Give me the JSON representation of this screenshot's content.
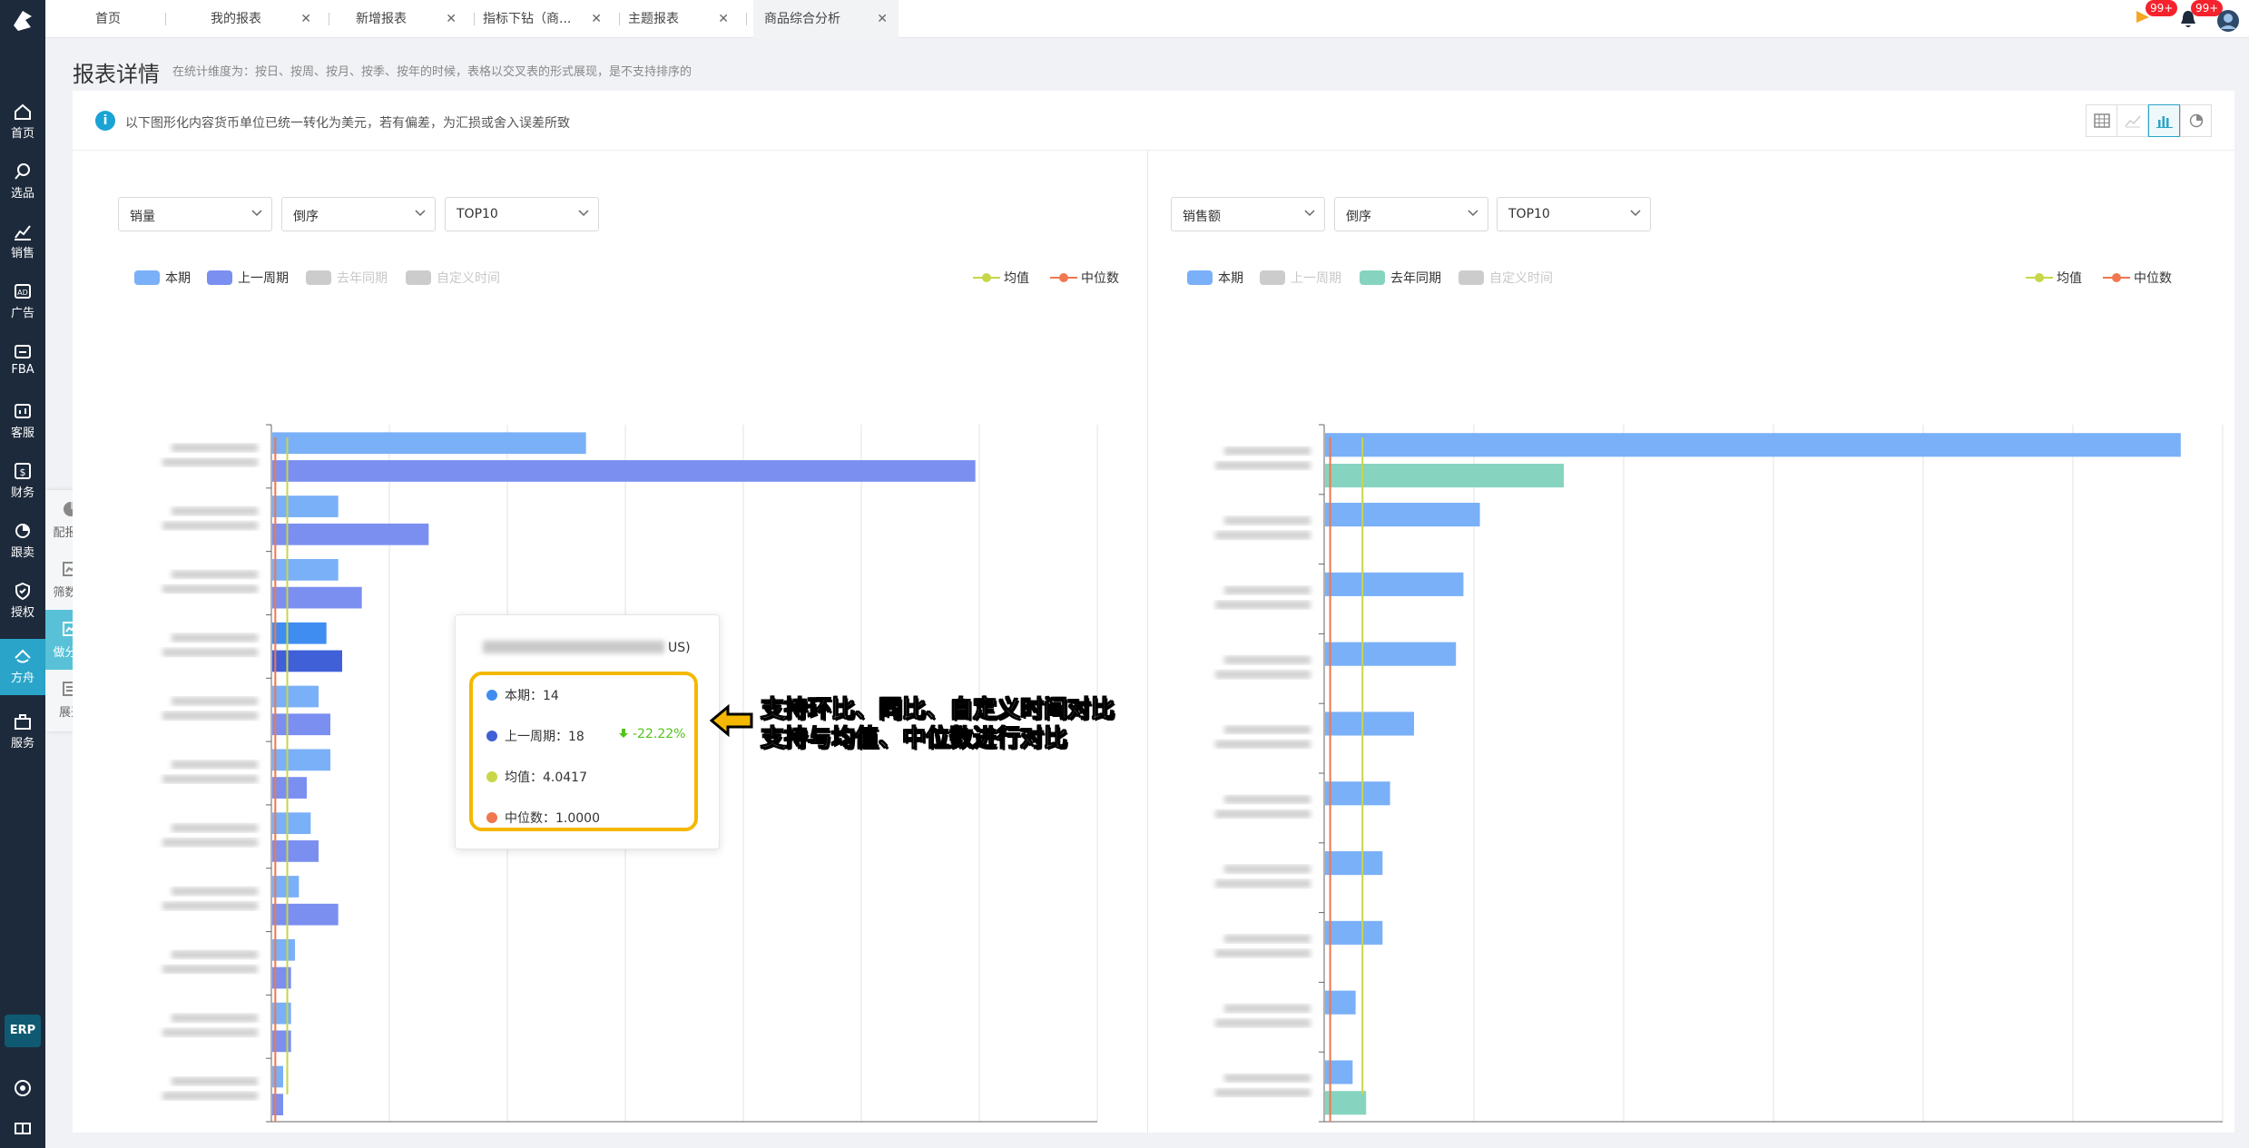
{
  "tabs": [
    {
      "label": "首页",
      "close": false
    },
    {
      "label": "我的报表",
      "close": true
    },
    {
      "label": "新增报表",
      "close": true
    },
    {
      "label": "指标下钻（商...",
      "close": true
    },
    {
      "label": "主题报表",
      "close": true
    },
    {
      "label": "商品综合分析",
      "close": true,
      "active": true
    }
  ],
  "notifications": {
    "flag_badge": "99+",
    "bell_badge": "99+"
  },
  "sidebar": [
    {
      "label": "首页",
      "icon": "home-icon"
    },
    {
      "label": "选品",
      "icon": "search-icon"
    },
    {
      "label": "销售",
      "icon": "trend-icon"
    },
    {
      "label": "广告",
      "icon": "ad-icon"
    },
    {
      "label": "FBA",
      "icon": "fba-icon"
    },
    {
      "label": "客服",
      "icon": "chat-icon"
    },
    {
      "label": "财务",
      "icon": "dollar-icon"
    },
    {
      "label": "跟卖",
      "icon": "pie-icon"
    },
    {
      "label": "授权",
      "icon": "shield-icon"
    },
    {
      "label": "方舟",
      "icon": "ark-icon",
      "active": true
    },
    {
      "label": "服务",
      "icon": "service-icon"
    }
  ],
  "erp_label": "ERP",
  "flyout": [
    {
      "label": "配报表",
      "icon": "pie-chart-icon"
    },
    {
      "label": "筛数据",
      "icon": "filter-data-icon"
    },
    {
      "label": "做分析",
      "icon": "analysis-icon",
      "active": true
    },
    {
      "label": "展开",
      "icon": "expand-icon"
    }
  ],
  "page": {
    "title": "报表详情",
    "subtitle": "在统计维度为：按日、按周、按月、按季、按年的时候，表格以交叉表的形式展现，是不支持排序的"
  },
  "notice": "以下图形化内容货币单位已统一转化为美元，若有偏差，为汇损或舍入误差所致",
  "colors": {
    "current": "#7ab0f7",
    "prev_period": "#7b8ff0",
    "last_year": "#86d4bf",
    "custom": "#cccccc",
    "mean": "#c8d648",
    "median": "#f0774f",
    "tooltip_border": "#f5b800",
    "accent": "#2aa5c9"
  },
  "left": {
    "selects": [
      "销量",
      "倒序",
      "TOP10"
    ],
    "legend": [
      {
        "label": "本期",
        "active": true
      },
      {
        "label": "上一周期",
        "active": true
      },
      {
        "label": "去年同期",
        "active": false
      },
      {
        "label": "自定义时间",
        "active": false
      }
    ],
    "lines_legend": [
      "均值",
      "中位数"
    ]
  },
  "right": {
    "selects": [
      "销售额",
      "倒序",
      "TOP10"
    ],
    "legend": [
      {
        "label": "本期",
        "active": true
      },
      {
        "label": "上一周期",
        "active": false
      },
      {
        "label": "去年同期",
        "active": true
      },
      {
        "label": "自定义时间",
        "active": false
      }
    ],
    "lines_legend": [
      "均值",
      "中位数"
    ]
  },
  "tooltip": {
    "header_suffix": "US)",
    "rows": [
      {
        "label": "本期：14",
        "color": "#3f8df0"
      },
      {
        "label": "上一周期：18",
        "color": "#4060d8",
        "change": "-22.22%"
      },
      {
        "label": "均值：4.0417",
        "color": "#c8d648"
      },
      {
        "label": "中位数：1.0000",
        "color": "#f0774f"
      }
    ]
  },
  "annotation": [
    "支持环比、同比、自定义时间对比",
    "支持与均值、中位数进行对比"
  ],
  "chart_data": [
    {
      "type": "bar",
      "orientation": "horizontal",
      "xlim": [
        0,
        210
      ],
      "x_ticks": [
        "0",
        "30",
        "60",
        "90",
        "120",
        "150",
        "180",
        "210"
      ],
      "series": [
        {
          "name": "本期",
          "values": [
            80,
            17,
            17,
            14,
            12,
            15,
            10,
            7,
            6,
            5,
            3
          ]
        },
        {
          "name": "上一周期",
          "values": [
            179,
            40,
            23,
            18,
            15,
            9,
            12,
            17,
            5,
            5,
            3
          ]
        }
      ],
      "mean": 4.0417,
      "median": 1.0,
      "grid": true
    },
    {
      "type": "bar",
      "orientation": "horizontal",
      "xlim": [
        0,
        3000
      ],
      "x_ticks": [
        "0",
        "500",
        "1,000",
        "1,500",
        "2,000",
        "2,500",
        "3,000"
      ],
      "series": [
        {
          "name": "本期",
          "values": [
            2860,
            520,
            465,
            440,
            300,
            220,
            195,
            195,
            105,
            95
          ]
        },
        {
          "name": "去年同期",
          "values": [
            800,
            0,
            0,
            0,
            0,
            0,
            0,
            0,
            0,
            140
          ]
        }
      ],
      "mean": 128,
      "median": 20,
      "grid": true
    }
  ]
}
